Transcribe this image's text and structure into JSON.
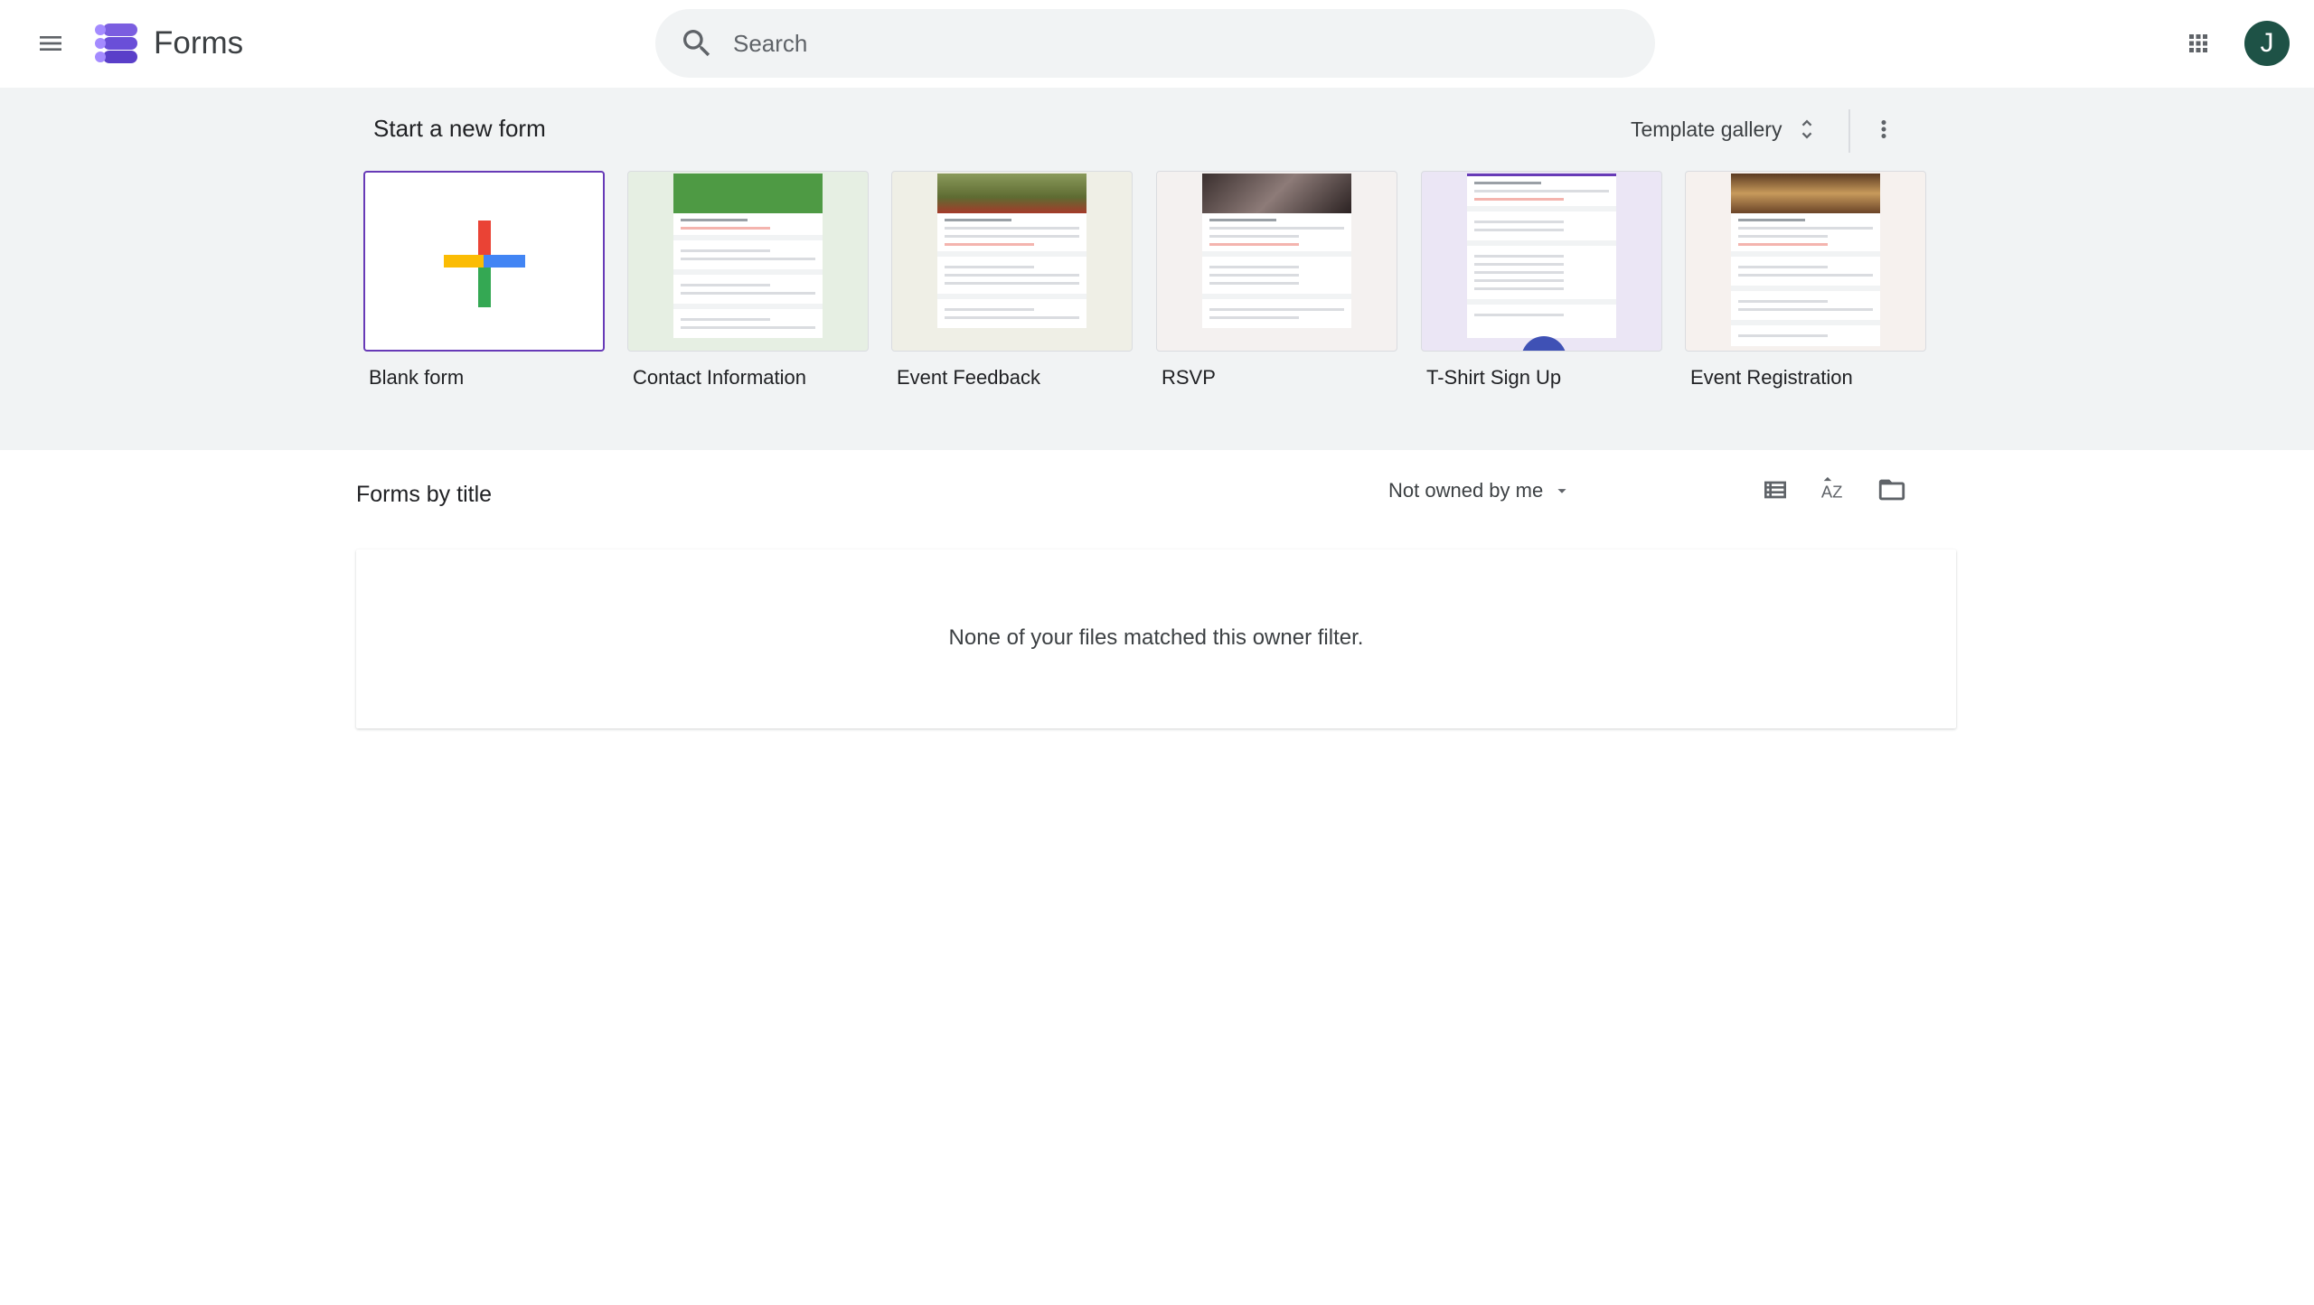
{
  "header": {
    "app_name": "Forms",
    "search_placeholder": "Search",
    "avatar_initial": "J"
  },
  "templates": {
    "section_label": "Start a new form",
    "gallery_label": "Template gallery",
    "items": [
      {
        "label": "Blank form"
      },
      {
        "label": "Contact Information",
        "hero_color": "#4e9a44",
        "bg": "#e6efe3"
      },
      {
        "label": "Event Feedback",
        "hero_color": "#6b7a3a",
        "bg": "#efefe6"
      },
      {
        "label": "RSVP",
        "hero_color": "#5a4a48",
        "bg": "#f4f1f0"
      },
      {
        "label": "T-Shirt Sign Up",
        "hero_color": "#ffffff",
        "bg": "#ebe6f5"
      },
      {
        "label": "Event Registration",
        "hero_color": "#7a4f2e",
        "bg": "#f6f1ee"
      }
    ]
  },
  "forms_list": {
    "title": "Forms by title",
    "owner_filter": "Not owned by me",
    "empty_message": "None of your files matched this owner filter."
  },
  "colors": {
    "accent": "#673ab7",
    "avatar_bg": "#1e5246",
    "section_bg": "#f1f3f4"
  }
}
